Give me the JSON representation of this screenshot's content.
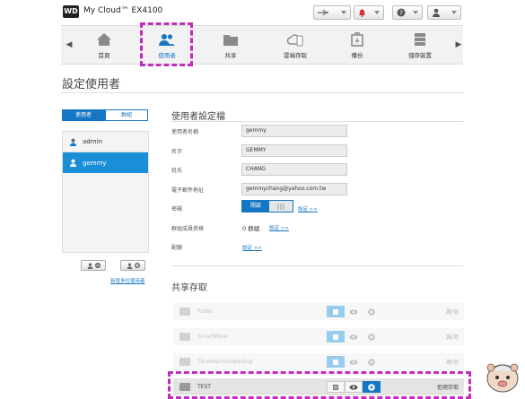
{
  "header": {
    "logo": "WD",
    "brand": "My Cloud™ EX4100"
  },
  "nav": {
    "items": [
      {
        "label": "首頁"
      },
      {
        "label": "使用者"
      },
      {
        "label": "共享"
      },
      {
        "label": "雲端存取"
      },
      {
        "label": "備份"
      },
      {
        "label": "儲存裝置"
      }
    ]
  },
  "page_title": "設定使用者",
  "tabs": {
    "users": "使用者",
    "groups": "群組"
  },
  "users": [
    {
      "name": "admin"
    },
    {
      "name": "gemmy"
    }
  ],
  "left_links": {
    "add_multiple": "新增多位使用者"
  },
  "profile": {
    "title": "使用者設定檔",
    "fields": {
      "username_label": "使用者名稱",
      "username_value": "gemmy",
      "firstname_label": "名字",
      "firstname_value": "GEMMY",
      "lastname_label": "姓氏",
      "lastname_value": "CHANG",
      "email_label": "電子郵件地址",
      "email_value": "gemmychang@yahoo.com.tw",
      "password_label": "密碼",
      "password_toggle_on": "開啟",
      "password_config": "設定 >>",
      "group_label": "群組成員資格",
      "group_value": "0 群組",
      "group_config": "設定 >>",
      "quota_label": "配額",
      "quota_config": "設定 >>"
    }
  },
  "shares": {
    "title": "共享存取",
    "rows": [
      {
        "name": "Public",
        "perm": "讀/寫"
      },
      {
        "name": "SmartWare",
        "perm": "讀/寫"
      },
      {
        "name": "TimeMachineBackup",
        "perm": "讀/寫"
      },
      {
        "name": "TEST",
        "perm": "拒絕存取"
      }
    ]
  },
  "colors": {
    "accent": "#1577c4",
    "highlight": "#c42bbd"
  }
}
